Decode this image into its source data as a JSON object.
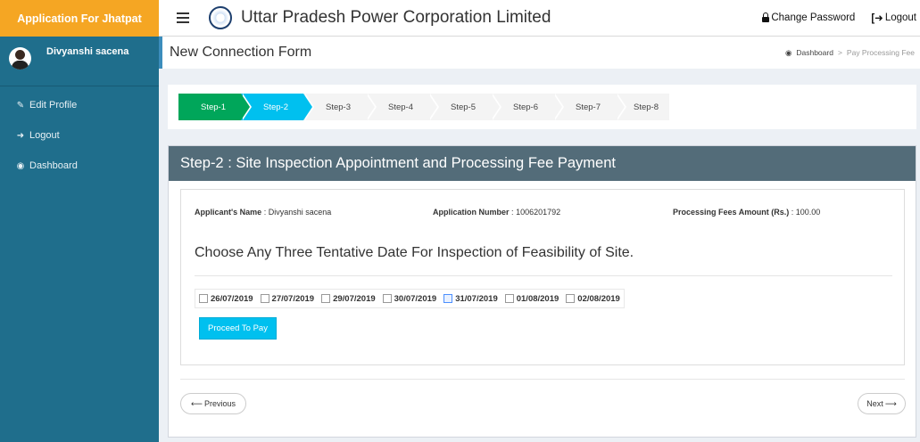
{
  "header": {
    "brand": "Application For Jhatpat",
    "org_title": "Uttar Pradesh Power Corporation Limited",
    "change_password": "Change Password",
    "logout": "Logout"
  },
  "sidebar": {
    "user_name": "Divyanshi sacena",
    "items": [
      {
        "label": "Edit Profile",
        "icon": "edit-icon"
      },
      {
        "label": "Logout",
        "icon": "logout-icon"
      },
      {
        "label": "Dashboard",
        "icon": "dashboard-icon"
      }
    ]
  },
  "page": {
    "title": "New Connection Form",
    "breadcrumb": {
      "home": "Dashboard",
      "sep": ">",
      "current": "Pay Processing Fee"
    }
  },
  "steps": [
    "Step-1",
    "Step-2",
    "Step-3",
    "Step-4",
    "Step-5",
    "Step-6",
    "Step-7",
    "Step-8"
  ],
  "panel": {
    "heading": "Step-2 : Site Inspection Appointment and Processing Fee Payment",
    "applicant_label": "Applicant's Name",
    "applicant_name": "Divyanshi sacena",
    "appno_label": "Application Number",
    "appno": "1006201792",
    "fee_label": "Processing Fees Amount (Rs.)",
    "fee": "100.00",
    "sep": ":",
    "choose_text": "Choose Any Three Tentative Date For Inspection of Feasibility of Site.",
    "dates": [
      "26/07/2019",
      "27/07/2019",
      "29/07/2019",
      "30/07/2019",
      "31/07/2019",
      "01/08/2019",
      "02/08/2019"
    ],
    "pay_button": "Proceed To Pay",
    "previous": "Previous",
    "next": "Next"
  },
  "colors": {
    "brand": "#f5a623",
    "sidebar": "#1f6e8c",
    "step_done": "#00a65a",
    "step_active": "#00c0ef",
    "panel_head": "#536c79"
  }
}
